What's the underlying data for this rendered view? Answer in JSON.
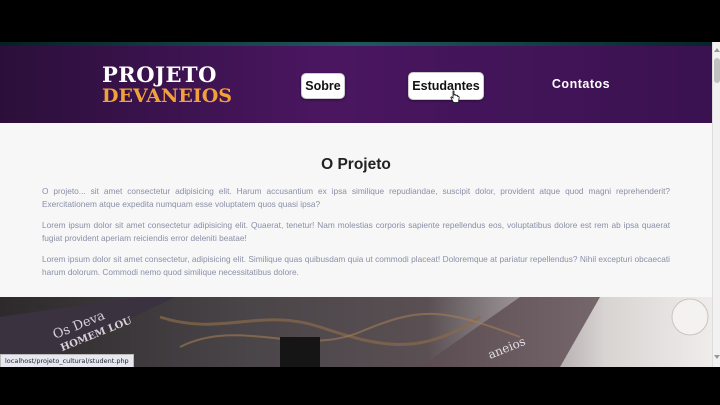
{
  "logo": {
    "line1": "PROJETO",
    "line2": "DEVANEIOS"
  },
  "nav": {
    "sobre": "Sobre",
    "estudantes": "Estudantes",
    "contatos": "Contatos"
  },
  "section": {
    "title": "O Projeto",
    "paragraphs": [
      "O projeto... sit amet consectetur adipisicing elit. Harum accusantium ex ipsa similique repudiandae, suscipit dolor, provident atque quod magni reprehenderit? Exercitationem atque expedita numquam esse voluptatem quos quasi ipsa?",
      "Lorem ipsum dolor sit amet consectetur adipisicing elit. Quaerat, tenetur! Nam molestias corporis sapiente repellendus eos, voluptatibus dolore est rem ab ipsa quaerat fugiat provident aperiam reiciendis error deleniti beatae!",
      "Lorem ipsum dolor sit amet consectetur, adipisicing elit. Similique quas quibusdam quia ut commodi placeat! Doloremque at pariatur repellendus? Nihil excepturi obcaecati harum dolorum. Commodi nemo quod similique necessitatibus dolore."
    ]
  },
  "photo": {
    "text_line1": "Os Deva",
    "text_line2": "HOMEM LOU",
    "text_line3": "aneios"
  },
  "status_url": "localhost/projeto_cultural/student.php",
  "colors": {
    "header_purple": "#4a1660",
    "logo_orange": "#f2a03a",
    "body_text": "#8a8fa6"
  }
}
